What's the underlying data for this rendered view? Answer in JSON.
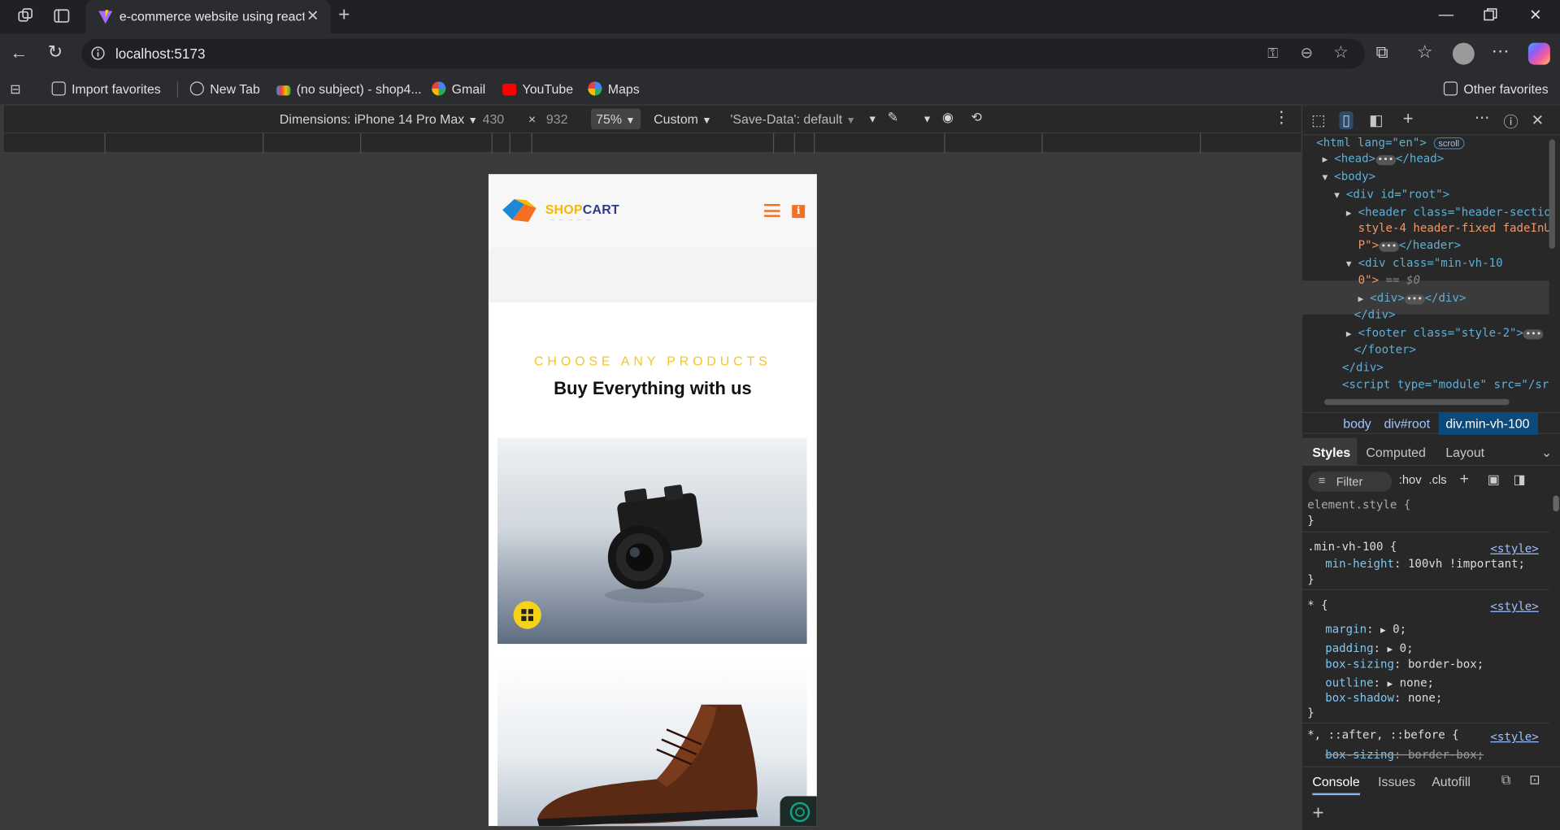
{
  "browser": {
    "tab_title": "e-commerce website using react js",
    "url": "localhost:5173",
    "favorites": [
      {
        "label": "Import favorites",
        "icon": "folder-import-icon"
      },
      {
        "label": "New Tab",
        "icon": "globe-icon"
      },
      {
        "label": "(no subject) - shop4...",
        "icon": "gmail-icon"
      },
      {
        "label": "Gmail",
        "icon": "google-icon"
      },
      {
        "label": "YouTube",
        "icon": "youtube-icon"
      },
      {
        "label": "Maps",
        "icon": "google-icon"
      }
    ],
    "other_favorites": "Other favorites"
  },
  "device_toolbar": {
    "dimensions_label": "Dimensions: iPhone 14 Pro Max",
    "width": "430",
    "times": "×",
    "height": "932",
    "zoom": "75%",
    "throttle": "Custom",
    "save_data": "'Save-Data': default"
  },
  "site": {
    "logo_primary": "SHOP",
    "logo_secondary": "CART",
    "kicker": "CHOOSE ANY PRODUCTS",
    "heading": "Buy Everything with us",
    "colors": {
      "accent_orange": "#f36f21",
      "accent_yellow": "#f3c623",
      "logo_navy": "#2c3a8c"
    }
  },
  "devtools": {
    "dom_lines": [
      {
        "pre": "<html lang=\"en\">",
        "badge": "scroll"
      },
      {
        "tag": "<head>",
        "dots": "•••",
        "close": "</head>"
      },
      {
        "tag": "<body>"
      },
      {
        "tag": "<div id=\"root\">"
      },
      {
        "tag": "<header class=\"header-section"
      },
      {
        "cont": "style-4 header-fixed fadeInU"
      },
      {
        "cont": "P\">",
        "dots": "•••",
        "close": "</header>"
      },
      {
        "tag": "<div class=\"min-vh-10"
      },
      {
        "cont": "0\">",
        "eq": "== $0"
      },
      {
        "tag": "<div>",
        "dots": "•••",
        "close": "</div>"
      },
      {
        "close": "</div>"
      },
      {
        "tag": "<footer class=\"style-2\">",
        "dots": "•••"
      },
      {
        "close": "</footer>"
      },
      {
        "close": "</div>"
      },
      {
        "tag": "<script type=\"module\" src=\"/sr"
      }
    ],
    "breadcrumbs": [
      "body",
      "div#root",
      "div.min-vh-100"
    ],
    "style_tabs": [
      "Styles",
      "Computed",
      "Layout"
    ],
    "filter_placeholder": "Filter",
    "hov": ":hov",
    "cls": ".cls",
    "rules": [
      {
        "selector": "element.style {",
        "close": "}"
      },
      {
        "selector": ".min-vh-100 {",
        "source": "<style>",
        "props": [
          {
            "name": "min-height",
            "value": "100vh !important;"
          }
        ],
        "close": "}"
      },
      {
        "selector": "* {",
        "source": "<style>",
        "props": [
          {
            "name": "margin",
            "value": "0;",
            "expand": true
          },
          {
            "name": "padding",
            "value": "0;",
            "expand": true
          },
          {
            "name": "box-sizing",
            "value": "border-box;"
          },
          {
            "name": "outline",
            "value": "none;",
            "expand": true
          },
          {
            "name": "box-shadow",
            "value": "none;"
          }
        ],
        "close": "}"
      },
      {
        "selector": "*, ::after, ::before {",
        "source": "<style>",
        "props": [
          {
            "name": "box-sizing",
            "value": "border-box;",
            "struck": true
          }
        ]
      }
    ],
    "console_tabs": [
      "Console",
      "Issues",
      "Autofill"
    ]
  }
}
